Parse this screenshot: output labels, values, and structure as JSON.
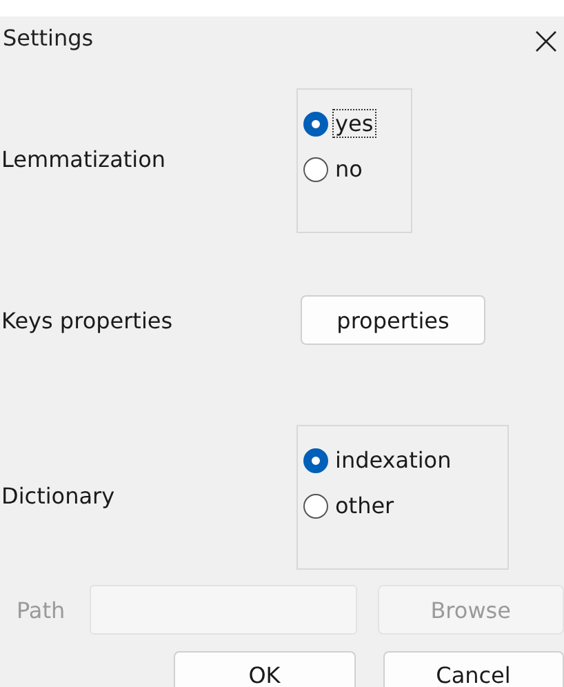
{
  "window": {
    "title": "Settings"
  },
  "rows": [
    {
      "kind": "radio",
      "label": "Lemmatization",
      "options": [
        {
          "label": "yes",
          "selected": true,
          "focused": true
        },
        {
          "label": "no",
          "selected": false,
          "focused": false
        }
      ]
    },
    {
      "kind": "button",
      "label": "Keys properties",
      "button": "properties"
    },
    {
      "kind": "radio",
      "label": "Dictionary",
      "options": [
        {
          "label": "indexation",
          "selected": true,
          "focused": false
        },
        {
          "label": "other",
          "selected": false,
          "focused": false
        }
      ]
    }
  ],
  "path": {
    "label": "Path",
    "disabled": true,
    "browse": "Browse"
  },
  "buttons": [
    "OK",
    "Cancel"
  ]
}
